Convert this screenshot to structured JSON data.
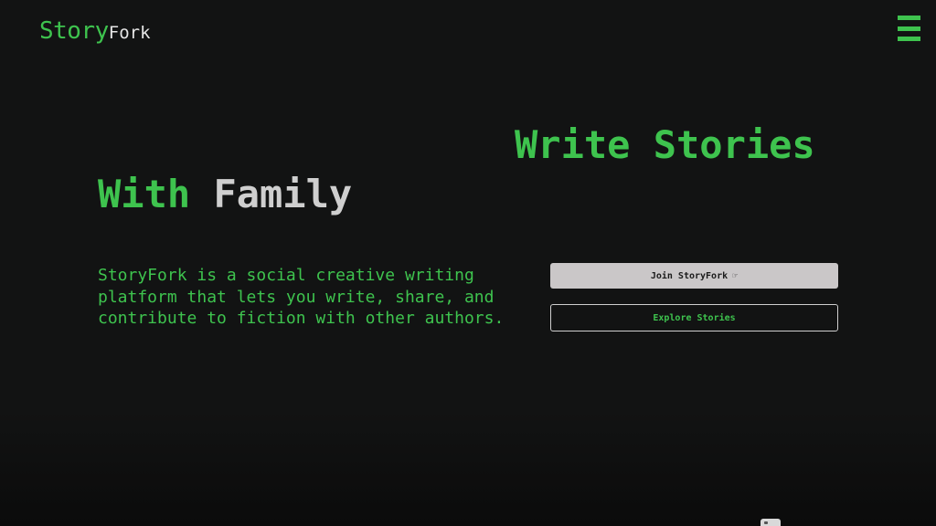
{
  "header": {
    "logo_primary": "Story",
    "logo_secondary": "Fork",
    "menu_icon": "hamburger-menu-icon"
  },
  "hero": {
    "line1": "Write Stories",
    "line2_accent": "With",
    "line2_rest": "Family"
  },
  "description": "StoryFork is a social creative writing platform that lets you write, share, and contribute to fiction with other authors.",
  "buttons": {
    "join_label": "Join StoryFork",
    "join_icon": "pointing-hand-icon",
    "explore_label": "Explore Stories"
  },
  "colors": {
    "accent": "#3ec34e",
    "background": "#121313",
    "text_light": "#cfcfcf",
    "button_bg": "#cac7c8"
  }
}
